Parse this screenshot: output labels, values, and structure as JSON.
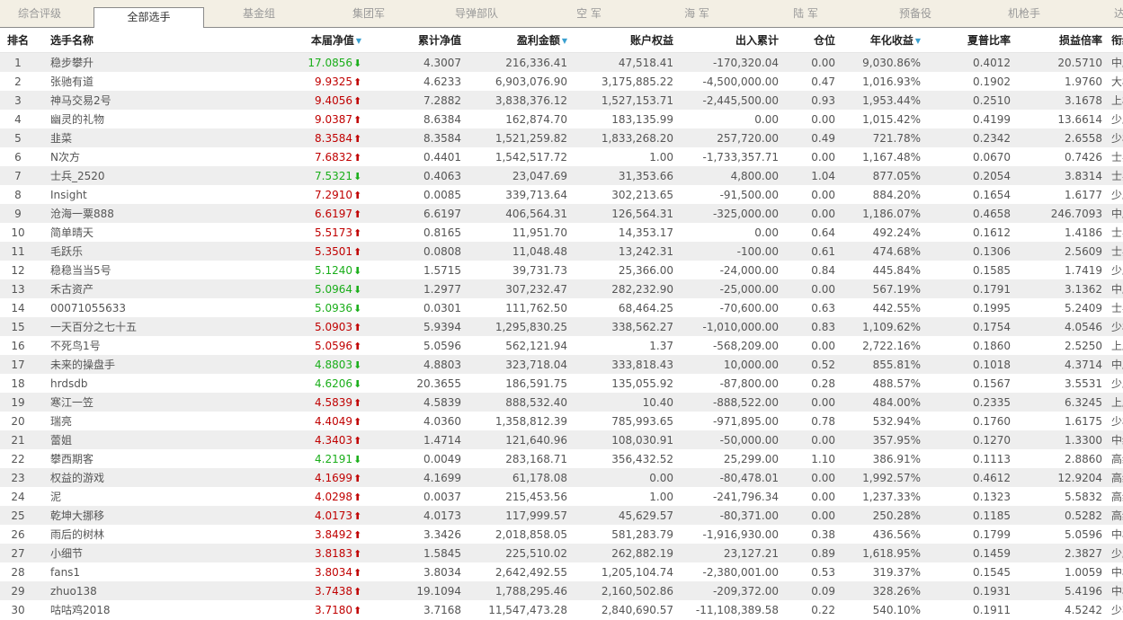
{
  "tabs": [
    "综合评级",
    "全部选手",
    "基金组",
    "集团军",
    "导弹部队",
    "空 军",
    "海 军",
    "陆 军",
    "预备役",
    "机枪手",
    "达"
  ],
  "active_tab": 1,
  "columns": [
    "排名",
    "选手名称",
    "本届净值",
    "累计净值",
    "盈利金额",
    "账户权益",
    "出入累计",
    "仓位",
    "年化收益",
    "夏普比率",
    "损益倍率",
    "衔级"
  ],
  "sorted_column_icon": "sort-triangle-icon",
  "colors": {
    "up": "#c00000",
    "down": "#1aae1a"
  },
  "rows": [
    {
      "rank": "1",
      "name": "稳步攀升",
      "nav": "17.0856",
      "dir": "down",
      "cum": "4.3007",
      "profit": "216,336.41",
      "equity": "47,518.41",
      "flow": "-170,320.04",
      "pos": "0.00",
      "annual": "9,030.86%",
      "sharpe": "0.4012",
      "ratio": "20.5710",
      "level": "中尉"
    },
    {
      "rank": "2",
      "name": "张驰有道",
      "nav": "9.9325",
      "dir": "up",
      "cum": "4.6233",
      "profit": "6,903,076.90",
      "equity": "3,175,885.22",
      "flow": "-4,500,000.00",
      "pos": "0.47",
      "annual": "1,016.93%",
      "sharpe": "0.1902",
      "ratio": "1.9760",
      "level": "大校"
    },
    {
      "rank": "3",
      "name": "神马交易2号",
      "nav": "9.4056",
      "dir": "up",
      "cum": "7.2882",
      "profit": "3,838,376.12",
      "equity": "1,527,153.71",
      "flow": "-2,445,500.00",
      "pos": "0.93",
      "annual": "1,953.44%",
      "sharpe": "0.2510",
      "ratio": "3.1678",
      "level": "上校"
    },
    {
      "rank": "4",
      "name": "幽灵的礼物",
      "nav": "9.0387",
      "dir": "up",
      "cum": "8.6384",
      "profit": "162,874.70",
      "equity": "183,135.99",
      "flow": "0.00",
      "pos": "0.00",
      "annual": "1,015.42%",
      "sharpe": "0.4199",
      "ratio": "13.6614",
      "level": "少尉"
    },
    {
      "rank": "5",
      "name": "韭菜",
      "nav": "8.3584",
      "dir": "up",
      "cum": "8.3584",
      "profit": "1,521,259.82",
      "equity": "1,833,268.20",
      "flow": "257,720.00",
      "pos": "0.49",
      "annual": "721.78%",
      "sharpe": "0.2342",
      "ratio": "2.6558",
      "level": "少校"
    },
    {
      "rank": "6",
      "name": "N次方",
      "nav": "7.6832",
      "dir": "up",
      "cum": "0.4401",
      "profit": "1,542,517.72",
      "equity": "1.00",
      "flow": "-1,733,357.71",
      "pos": "0.00",
      "annual": "1,167.48%",
      "sharpe": "0.0670",
      "ratio": "0.7426",
      "level": "士兵"
    },
    {
      "rank": "7",
      "name": "士兵_2520",
      "nav": "7.5321",
      "dir": "down",
      "cum": "0.4063",
      "profit": "23,047.69",
      "equity": "31,353.66",
      "flow": "4,800.00",
      "pos": "1.04",
      "annual": "877.05%",
      "sharpe": "0.2054",
      "ratio": "3.8314",
      "level": "士兵"
    },
    {
      "rank": "8",
      "name": "Insight",
      "nav": "7.2910",
      "dir": "up",
      "cum": "0.0085",
      "profit": "339,713.64",
      "equity": "302,213.65",
      "flow": "-91,500.00",
      "pos": "0.00",
      "annual": "884.20%",
      "sharpe": "0.1654",
      "ratio": "1.6177",
      "level": "少尉"
    },
    {
      "rank": "9",
      "name": "沧海一粟888",
      "nav": "6.6197",
      "dir": "up",
      "cum": "6.6197",
      "profit": "406,564.31",
      "equity": "126,564.31",
      "flow": "-325,000.00",
      "pos": "0.00",
      "annual": "1,186.07%",
      "sharpe": "0.4658",
      "ratio": "246.7093",
      "level": "中尉"
    },
    {
      "rank": "10",
      "name": "简单晴天",
      "nav": "5.5173",
      "dir": "up",
      "cum": "0.8165",
      "profit": "11,951.70",
      "equity": "14,353.17",
      "flow": "0.00",
      "pos": "0.64",
      "annual": "492.24%",
      "sharpe": "0.1612",
      "ratio": "1.4186",
      "level": "士兵"
    },
    {
      "rank": "11",
      "name": "毛跃乐",
      "nav": "5.3501",
      "dir": "up",
      "cum": "0.0808",
      "profit": "11,048.48",
      "equity": "13,242.31",
      "flow": "-100.00",
      "pos": "0.61",
      "annual": "474.68%",
      "sharpe": "0.1306",
      "ratio": "2.5609",
      "level": "士兵"
    },
    {
      "rank": "12",
      "name": "稳稳当当5号",
      "nav": "5.1240",
      "dir": "down",
      "cum": "1.5715",
      "profit": "39,731.73",
      "equity": "25,366.00",
      "flow": "-24,000.00",
      "pos": "0.84",
      "annual": "445.84%",
      "sharpe": "0.1585",
      "ratio": "1.7419",
      "level": "少尉"
    },
    {
      "rank": "13",
      "name": "禾古资产",
      "nav": "5.0964",
      "dir": "down",
      "cum": "1.2977",
      "profit": "307,232.47",
      "equity": "282,232.90",
      "flow": "-25,000.00",
      "pos": "0.00",
      "annual": "567.19%",
      "sharpe": "0.1791",
      "ratio": "3.1362",
      "level": "中尉"
    },
    {
      "rank": "14",
      "name": "00071055633",
      "nav": "5.0936",
      "dir": "down",
      "cum": "0.0301",
      "profit": "111,762.50",
      "equity": "68,464.25",
      "flow": "-70,600.00",
      "pos": "0.63",
      "annual": "442.55%",
      "sharpe": "0.1995",
      "ratio": "5.2409",
      "level": "士兵"
    },
    {
      "rank": "15",
      "name": "一天百分之七十五",
      "nav": "5.0903",
      "dir": "up",
      "cum": "5.9394",
      "profit": "1,295,830.25",
      "equity": "338,562.27",
      "flow": "-1,010,000.00",
      "pos": "0.83",
      "annual": "1,109.62%",
      "sharpe": "0.1754",
      "ratio": "4.0546",
      "level": "少校"
    },
    {
      "rank": "16",
      "name": "不死鸟1号",
      "nav": "5.0596",
      "dir": "up",
      "cum": "5.0596",
      "profit": "562,121.94",
      "equity": "1.37",
      "flow": "-568,209.00",
      "pos": "0.00",
      "annual": "2,722.16%",
      "sharpe": "0.1860",
      "ratio": "2.5250",
      "level": "上尉"
    },
    {
      "rank": "17",
      "name": "未来的操盘手",
      "nav": "4.8803",
      "dir": "down",
      "cum": "4.8803",
      "profit": "323,718.04",
      "equity": "333,818.43",
      "flow": "10,000.00",
      "pos": "0.52",
      "annual": "855.81%",
      "sharpe": "0.1018",
      "ratio": "4.3714",
      "level": "中尉"
    },
    {
      "rank": "18",
      "name": "hrdsdb",
      "nav": "4.6206",
      "dir": "down",
      "cum": "20.3655",
      "profit": "186,591.75",
      "equity": "135,055.92",
      "flow": "-87,800.00",
      "pos": "0.28",
      "annual": "488.57%",
      "sharpe": "0.1567",
      "ratio": "3.5531",
      "level": "少尉"
    },
    {
      "rank": "19",
      "name": "寒江一笠",
      "nav": "4.5839",
      "dir": "up",
      "cum": "4.5839",
      "profit": "888,532.40",
      "equity": "10.40",
      "flow": "-888,522.00",
      "pos": "0.00",
      "annual": "484.00%",
      "sharpe": "0.2335",
      "ratio": "6.3245",
      "level": "上尉"
    },
    {
      "rank": "20",
      "name": "瑞亮",
      "nav": "4.4049",
      "dir": "up",
      "cum": "4.0360",
      "profit": "1,358,812.39",
      "equity": "785,993.65",
      "flow": "-971,895.00",
      "pos": "0.78",
      "annual": "532.94%",
      "sharpe": "0.1760",
      "ratio": "1.6175",
      "level": "少校"
    },
    {
      "rank": "21",
      "name": "蕾姐",
      "nav": "4.3403",
      "dir": "up",
      "cum": "1.4714",
      "profit": "121,640.96",
      "equity": "108,030.91",
      "flow": "-50,000.00",
      "pos": "0.00",
      "annual": "357.95%",
      "sharpe": "0.1270",
      "ratio": "1.3300",
      "level": "中级士官"
    },
    {
      "rank": "22",
      "name": "攀西期客",
      "nav": "4.2191",
      "dir": "down",
      "cum": "0.0049",
      "profit": "283,168.71",
      "equity": "356,432.52",
      "flow": "25,299.00",
      "pos": "1.10",
      "annual": "386.91%",
      "sharpe": "0.1113",
      "ratio": "2.8860",
      "level": "高级士官"
    },
    {
      "rank": "23",
      "name": "权益的游戏",
      "nav": "4.1699",
      "dir": "up",
      "cum": "4.1699",
      "profit": "61,178.08",
      "equity": "0.00",
      "flow": "-80,478.01",
      "pos": "0.00",
      "annual": "1,992.57%",
      "sharpe": "0.4612",
      "ratio": "12.9204",
      "level": "高级士官"
    },
    {
      "rank": "24",
      "name": "泥",
      "nav": "4.0298",
      "dir": "up",
      "cum": "0.0037",
      "profit": "215,453.56",
      "equity": "1.00",
      "flow": "-241,796.34",
      "pos": "0.00",
      "annual": "1,237.33%",
      "sharpe": "0.1323",
      "ratio": "5.5832",
      "level": "高级士官"
    },
    {
      "rank": "25",
      "name": "乾坤大挪移",
      "nav": "4.0173",
      "dir": "up",
      "cum": "4.0173",
      "profit": "117,999.57",
      "equity": "45,629.57",
      "flow": "-80,371.00",
      "pos": "0.00",
      "annual": "250.28%",
      "sharpe": "0.1185",
      "ratio": "0.5282",
      "level": "高级士官"
    },
    {
      "rank": "26",
      "name": "雨后的树林",
      "nav": "3.8492",
      "dir": "up",
      "cum": "3.3426",
      "profit": "2,018,858.05",
      "equity": "581,283.79",
      "flow": "-1,916,930.00",
      "pos": "0.38",
      "annual": "436.56%",
      "sharpe": "0.1799",
      "ratio": "5.0596",
      "level": "中校"
    },
    {
      "rank": "27",
      "name": "小细节",
      "nav": "3.8183",
      "dir": "up",
      "cum": "1.5845",
      "profit": "225,510.02",
      "equity": "262,882.19",
      "flow": "23,127.21",
      "pos": "0.89",
      "annual": "1,618.95%",
      "sharpe": "0.1459",
      "ratio": "2.3827",
      "level": "少尉"
    },
    {
      "rank": "28",
      "name": "fans1",
      "nav": "3.8034",
      "dir": "up",
      "cum": "3.8034",
      "profit": "2,642,492.55",
      "equity": "1,205,104.74",
      "flow": "-2,380,001.00",
      "pos": "0.53",
      "annual": "319.37%",
      "sharpe": "0.1545",
      "ratio": "1.0059",
      "level": "中校"
    },
    {
      "rank": "29",
      "name": "zhuo138",
      "nav": "3.7438",
      "dir": "up",
      "cum": "19.1094",
      "profit": "1,788,295.46",
      "equity": "2,160,502.86",
      "flow": "-209,372.00",
      "pos": "0.09",
      "annual": "328.26%",
      "sharpe": "0.1931",
      "ratio": "5.4196",
      "level": "中校"
    },
    {
      "rank": "30",
      "name": "咕咕鸡2018",
      "nav": "3.7180",
      "dir": "up",
      "cum": "3.7168",
      "profit": "11,547,473.28",
      "equity": "2,840,690.57",
      "flow": "-11,108,389.58",
      "pos": "0.22",
      "annual": "540.10%",
      "sharpe": "0.1911",
      "ratio": "4.5242",
      "level": "少将"
    }
  ]
}
